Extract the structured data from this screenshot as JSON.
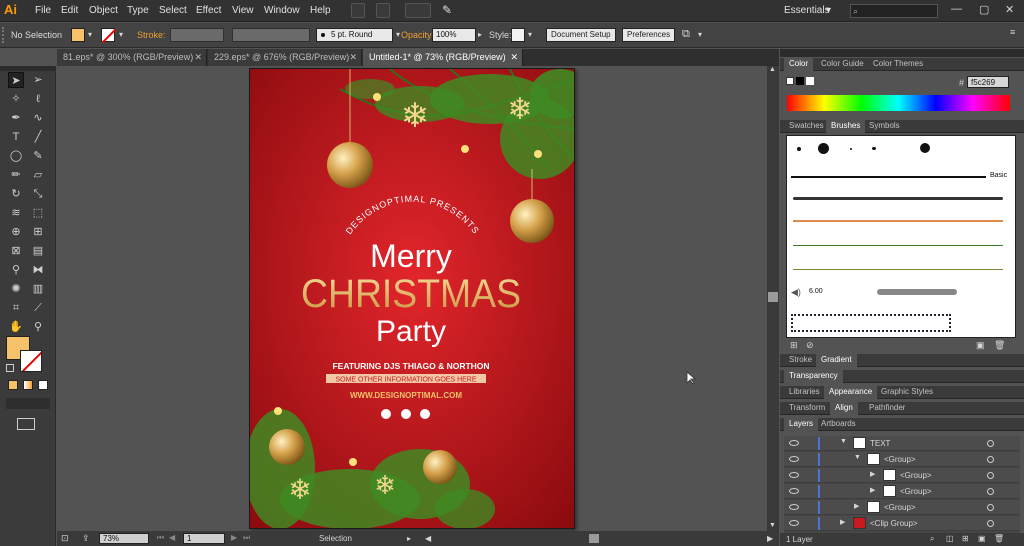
{
  "app": {
    "logo": "Ai"
  },
  "menubar": {
    "items": [
      "File",
      "Edit",
      "Object",
      "Type",
      "Select",
      "Effect",
      "View",
      "Window",
      "Help"
    ],
    "workspace": "Essentials",
    "workspace_arrow": "▾",
    "search_icon": "search-icon"
  },
  "control": {
    "selection_label": "No Selection",
    "fill_color": "#f5c269",
    "stroke_label": "Stroke:",
    "brush_label": "5 pt. Round",
    "opacity_label": "Opacity:",
    "opacity_value": "100%",
    "style_label": "Style:",
    "doc_setup": "Document Setup",
    "preferences": "Preferences"
  },
  "tabs": [
    {
      "label": "81.eps* @ 300% (RGB/Preview)",
      "close": "✕"
    },
    {
      "label": "229.eps* @ 676% (RGB/Preview)",
      "close": "✕"
    },
    {
      "label": "Untitled-1* @ 73% (RGB/Preview)",
      "close": "✕"
    }
  ],
  "artwork": {
    "presents": "DESIGNOPTIMAL PRESENTS",
    "merry": "Merry",
    "christmas": "CHRISTMAS",
    "party": "Party",
    "featuring": "FEATURING DJS THIAGO & NORTHON",
    "tagline": "SOME OTHER INFORMATION GOES HERE",
    "website": "WWW.DESIGNOPTIMAL.COM",
    "bg_color": "#c81a1e",
    "gold": "#e9b96a"
  },
  "status": {
    "zoom": "73%",
    "page": "1",
    "tool": "Selection"
  },
  "panels": {
    "color_tabs": [
      "Color",
      "Color Guide",
      "Color Themes"
    ],
    "hex": "f5c269",
    "hash": "#",
    "brush_tabs": [
      "Swatches",
      "Brushes",
      "Symbols"
    ],
    "brush_basic": "Basic",
    "brush_size": "6.00",
    "stroke_tabs": [
      "Stroke",
      "Gradient"
    ],
    "transparency": "Transparency",
    "lib_tabs": [
      "Libraries",
      "Appearance",
      "Graphic Styles"
    ],
    "transform_tabs": [
      "Transform",
      "Align",
      "Pathfinder"
    ],
    "layer_tabs": [
      "Layers",
      "Artboards"
    ],
    "layers": [
      {
        "name": "TEXT",
        "indent": 0
      },
      {
        "name": "<Group>",
        "indent": 1
      },
      {
        "name": "<Group>",
        "indent": 2
      },
      {
        "name": "<Group>",
        "indent": 2
      },
      {
        "name": "<Group>",
        "indent": 1
      },
      {
        "name": "<Clip Group>",
        "indent": 0
      }
    ],
    "layers_count": "1 Layer"
  }
}
